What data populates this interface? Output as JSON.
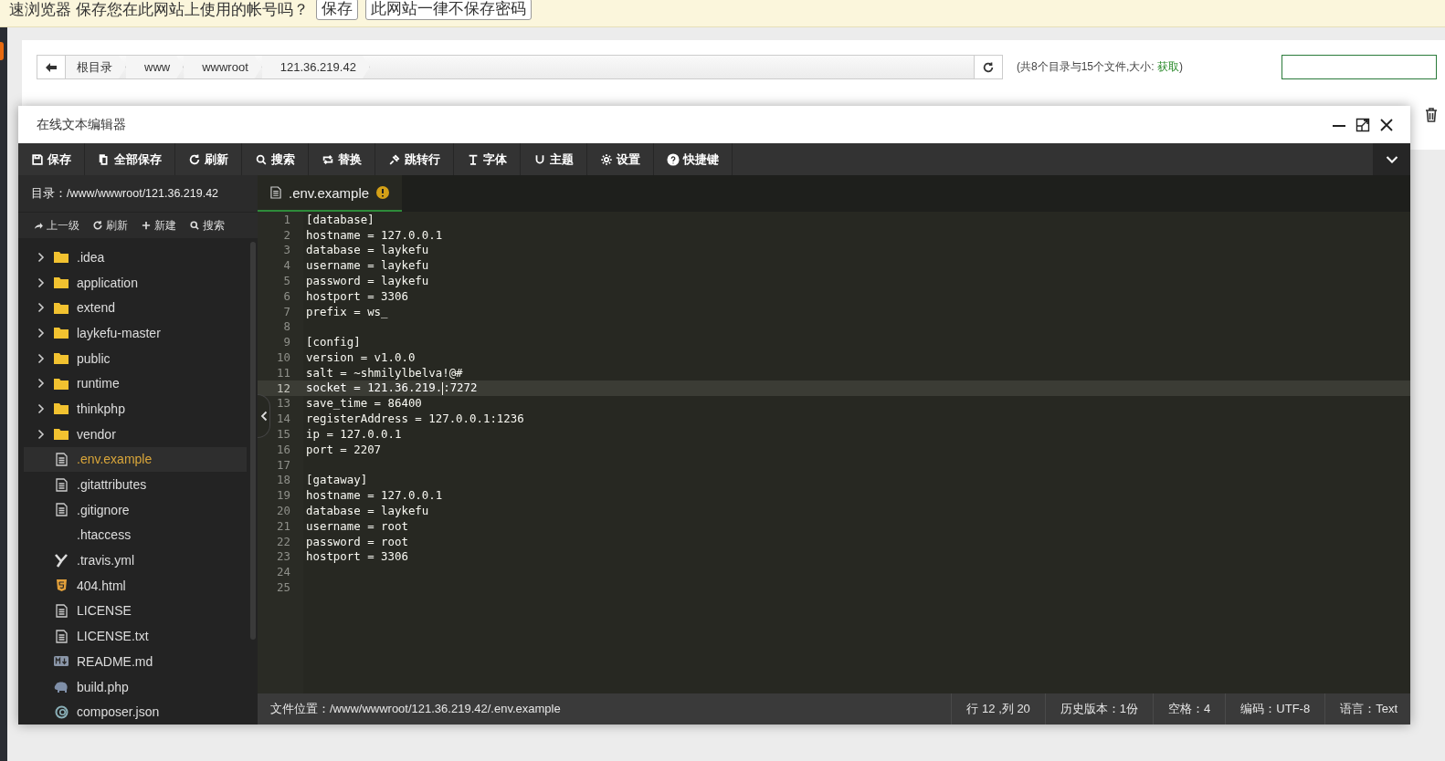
{
  "password_prompt": {
    "message": "速浏览器 保存您在此网站上使用的帐号吗？",
    "buttons": [
      "保存",
      "此网站一律不保存密码"
    ]
  },
  "file_manager": {
    "breadcrumbs": [
      "根目录",
      "www",
      "wwwroot",
      "121.36.219.42"
    ],
    "summary": "(共8个目录与15个文件,大小: ",
    "summary_link": "获取",
    "summary_end": ")"
  },
  "editor": {
    "title": "在线文本编辑器",
    "toolbar": [
      {
        "label": "保存"
      },
      {
        "label": "全部保存"
      },
      {
        "label": "刷新"
      },
      {
        "label": "搜索"
      },
      {
        "label": "替换"
      },
      {
        "label": "跳转行"
      },
      {
        "label": "字体"
      },
      {
        "label": "主题"
      },
      {
        "label": "设置"
      },
      {
        "label": "快捷键"
      }
    ],
    "directory": "目录：/www/wwwroot/121.36.219.42",
    "sidebar_actions": [
      "上一级",
      "刷新",
      "新建",
      "搜索"
    ],
    "files": [
      {
        "name": ".idea",
        "kind": "folder",
        "expanded": false,
        "selected": false
      },
      {
        "name": "application",
        "kind": "folder",
        "expanded": false,
        "selected": false
      },
      {
        "name": "extend",
        "kind": "folder",
        "expanded": false,
        "selected": false
      },
      {
        "name": "laykefu-master",
        "kind": "folder",
        "expanded": false,
        "selected": false
      },
      {
        "name": "public",
        "kind": "folder",
        "expanded": false,
        "selected": false
      },
      {
        "name": "runtime",
        "kind": "folder",
        "expanded": false,
        "selected": false
      },
      {
        "name": "thinkphp",
        "kind": "folder",
        "expanded": false,
        "selected": false
      },
      {
        "name": "vendor",
        "kind": "folder",
        "expanded": false,
        "selected": false
      },
      {
        "name": ".env.example",
        "kind": "text",
        "selected": true
      },
      {
        "name": ".gitattributes",
        "kind": "text",
        "selected": false
      },
      {
        "name": ".gitignore",
        "kind": "text",
        "selected": false
      },
      {
        "name": ".htaccess",
        "kind": "plain",
        "selected": false
      },
      {
        "name": ".travis.yml",
        "kind": "yaml",
        "selected": false
      },
      {
        "name": "404.html",
        "kind": "html",
        "selected": false
      },
      {
        "name": "LICENSE",
        "kind": "text",
        "selected": false
      },
      {
        "name": "LICENSE.txt",
        "kind": "text",
        "selected": false
      },
      {
        "name": "README.md",
        "kind": "markdown",
        "selected": false
      },
      {
        "name": "build.php",
        "kind": "php",
        "selected": false
      },
      {
        "name": "composer.json",
        "kind": "json",
        "selected": false
      }
    ],
    "tabs": [
      {
        "label": ".env.example",
        "modified": true,
        "selected": true
      }
    ],
    "lines": [
      {
        "number": "1",
        "text": "[database]",
        "active": false
      },
      {
        "number": "2",
        "text": "hostname = 127.0.0.1",
        "active": false
      },
      {
        "number": "3",
        "text": "database = laykefu",
        "active": false
      },
      {
        "number": "4",
        "text": "username = laykefu",
        "active": false
      },
      {
        "number": "5",
        "text": "password = laykefu",
        "active": false
      },
      {
        "number": "6",
        "text": "hostport = 3306",
        "active": false
      },
      {
        "number": "7",
        "text": "prefix = ws_",
        "active": false
      },
      {
        "number": "8",
        "active": false
      },
      {
        "number": "9",
        "text": "[config]",
        "active": false
      },
      {
        "number": "10",
        "text": "version = v1.0.0",
        "active": false
      },
      {
        "number": "11",
        "text": "salt = ~shmilylbelva!@#",
        "active": false
      },
      {
        "number": "12",
        "text": "socket = 121.36.219.",
        "text_after_cursor": ":7272",
        "active": true
      },
      {
        "number": "13",
        "text": "save_time = 86400",
        "active": false
      },
      {
        "number": "14",
        "text": "registerAddress = 127.0.0.1:1236",
        "active": false
      },
      {
        "number": "15",
        "text": "ip = 127.0.0.1",
        "active": false
      },
      {
        "number": "16",
        "text": "port = 2207",
        "active": false
      },
      {
        "number": "17",
        "active": false
      },
      {
        "number": "18",
        "text": "[gataway]",
        "active": false
      },
      {
        "number": "19",
        "text": "hostname = 127.0.0.1",
        "active": false
      },
      {
        "number": "20",
        "text": "database = laykefu",
        "active": false
      },
      {
        "number": "21",
        "text": "username = root",
        "active": false
      },
      {
        "number": "22",
        "text": "password = root",
        "active": false
      },
      {
        "number": "23",
        "text": "hostport = 3306",
        "active": false
      },
      {
        "number": "24",
        "active": false
      },
      {
        "number": "25",
        "active": false
      }
    ],
    "status": {
      "path": "文件位置：/www/wwwroot/121.36.219.42/.env.example",
      "items": [
        "行 12 ,列 20",
        "历史版本：1份",
        "空格：4",
        "编码：UTF-8",
        "语言：Text"
      ]
    }
  }
}
